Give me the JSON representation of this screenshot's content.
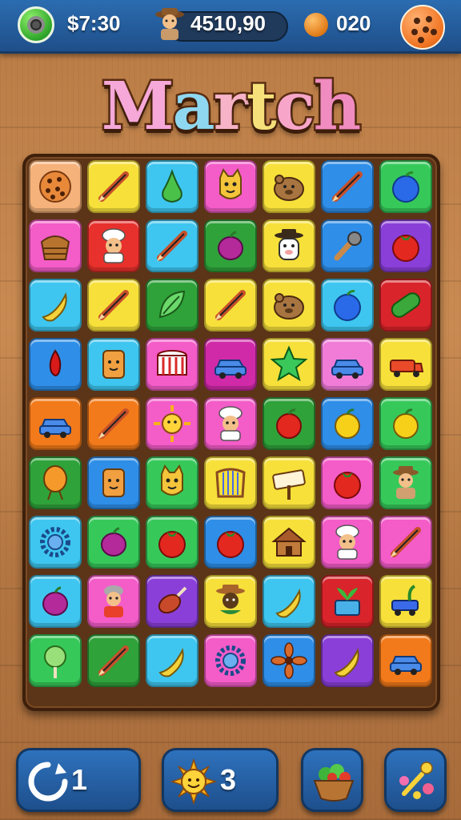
{
  "hud": {
    "timer": "$7:30",
    "score": "4510,90",
    "coins": "020"
  },
  "title": {
    "letters": [
      "M",
      "a",
      "r",
      "t",
      "c",
      "h"
    ],
    "colors": [
      "#f6a8d8",
      "#8fd7f0",
      "#f7b3c7",
      "#f5e07a",
      "#f7a6c9",
      "#f08cc0"
    ]
  },
  "board": {
    "rows": [
      [
        {
          "bg": "#f5b27a",
          "icon": "cookie-icon"
        },
        {
          "bg": "#f7e03a",
          "icon": "pencil-icon"
        },
        {
          "bg": "#3ec6f0",
          "icon": "pear-icon"
        },
        {
          "bg": "#f45cc8",
          "icon": "cat-icon"
        },
        {
          "bg": "#f7e03a",
          "icon": "bear-icon"
        },
        {
          "bg": "#2e8ee8",
          "icon": "pencil-icon"
        },
        {
          "bg": "#36c95a",
          "icon": "blue-apple-icon"
        }
      ],
      [
        {
          "bg": "#f45cc8",
          "icon": "basket-icon"
        },
        {
          "bg": "#e8312c",
          "icon": "chef-icon"
        },
        {
          "bg": "#3ec6f0",
          "icon": "pencil-icon"
        },
        {
          "bg": "#2fa23a",
          "icon": "plum-icon"
        },
        {
          "bg": "#f7e03a",
          "icon": "hat-cow-icon"
        },
        {
          "bg": "#2e8ee8",
          "icon": "microphone-icon"
        },
        {
          "bg": "#8a3fd8",
          "icon": "tomato-icon"
        }
      ],
      [
        {
          "bg": "#3ec6f0",
          "icon": "banana-icon"
        },
        {
          "bg": "#f7e03a",
          "icon": "pencil-icon"
        },
        {
          "bg": "#2fa23a",
          "icon": "leaf-icon"
        },
        {
          "bg": "#f7e03a",
          "icon": "pencil-icon"
        },
        {
          "bg": "#f7e03a",
          "icon": "bear-icon"
        },
        {
          "bg": "#3ec6f0",
          "icon": "blue-apple-icon"
        },
        {
          "bg": "#d8242a",
          "icon": "cucumber-icon"
        }
      ],
      [
        {
          "bg": "#2e8ee8",
          "icon": "chili-icon"
        },
        {
          "bg": "#3ec6f0",
          "icon": "toast-icon"
        },
        {
          "bg": "#f45cc8",
          "icon": "drum-icon"
        },
        {
          "bg": "#d02aa8",
          "icon": "car-icon"
        },
        {
          "bg": "#f7e03a",
          "icon": "star-icon"
        },
        {
          "bg": "#f07cd8",
          "icon": "car-icon"
        },
        {
          "bg": "#f7e03a",
          "icon": "truck-icon"
        }
      ],
      [
        {
          "bg": "#f27a1a",
          "icon": "car-icon"
        },
        {
          "bg": "#f27a1a",
          "icon": "pencil-icon"
        },
        {
          "bg": "#f45cc8",
          "icon": "sun-icon"
        },
        {
          "bg": "#f45cc8",
          "icon": "chef-icon"
        },
        {
          "bg": "#2fa23a",
          "icon": "red-apple-icon"
        },
        {
          "bg": "#2e8ee8",
          "icon": "yellow-apple-icon"
        },
        {
          "bg": "#36c95a",
          "icon": "yellow-apple-icon"
        }
      ],
      [
        {
          "bg": "#2fa23a",
          "icon": "balloon-icon"
        },
        {
          "bg": "#2e8ee8",
          "icon": "toast-icon"
        },
        {
          "bg": "#36c95a",
          "icon": "cat-icon"
        },
        {
          "bg": "#f7e03a",
          "icon": "harp-icon"
        },
        {
          "bg": "#f7e03a",
          "icon": "sign-icon"
        },
        {
          "bg": "#f45cc8",
          "icon": "tomato-icon"
        },
        {
          "bg": "#36c95a",
          "icon": "farmer-icon"
        }
      ],
      [
        {
          "bg": "#3ec6f0",
          "icon": "gear-icon"
        },
        {
          "bg": "#36c95a",
          "icon": "plum-icon"
        },
        {
          "bg": "#36c95a",
          "icon": "tomato-icon"
        },
        {
          "bg": "#2e8ee8",
          "icon": "tomato-icon"
        },
        {
          "bg": "#f7e03a",
          "icon": "house-icon"
        },
        {
          "bg": "#f45cc8",
          "icon": "chef-icon"
        },
        {
          "bg": "#f45cc8",
          "icon": "pencil-icon"
        }
      ],
      [
        {
          "bg": "#3ec6f0",
          "icon": "plum-icon"
        },
        {
          "bg": "#f45cc8",
          "icon": "grandma-icon"
        },
        {
          "bg": "#8a3fd8",
          "icon": "meat-icon"
        },
        {
          "bg": "#f7e03a",
          "icon": "cowboy-icon"
        },
        {
          "bg": "#3ec6f0",
          "icon": "banana-icon"
        },
        {
          "bg": "#d8242a",
          "icon": "plant-icon"
        },
        {
          "bg": "#f7e03a",
          "icon": "cart-icon"
        }
      ],
      [
        {
          "bg": "#36c95a",
          "icon": "lollipop-icon"
        },
        {
          "bg": "#2fa23a",
          "icon": "pencil-icon"
        },
        {
          "bg": "#3ec6f0",
          "icon": "banana-icon"
        },
        {
          "bg": "#f45cc8",
          "icon": "gear-icon"
        },
        {
          "bg": "#2e8ee8",
          "icon": "flower-icon"
        },
        {
          "bg": "#8a3fd8",
          "icon": "banana-icon"
        },
        {
          "bg": "#f27a1a",
          "icon": "car-icon"
        }
      ]
    ]
  },
  "boosters": {
    "shuffle_count": "1",
    "sun_count": "3"
  }
}
